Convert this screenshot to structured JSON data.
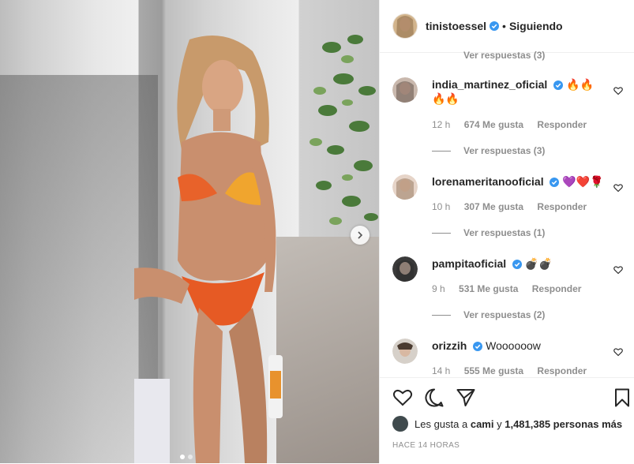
{
  "post": {
    "username": "tinistoessel",
    "bullet": "•",
    "follow_status": "Siguiendo"
  },
  "comments": {
    "top_replies": "Ver respuestas (3)",
    "items": [
      {
        "user": "india_martinez_oficial",
        "text": "🔥🔥🔥🔥",
        "time": "12 h",
        "likes": "674 Me gusta",
        "reply": "Responder",
        "replies": "Ver respuestas (3)"
      },
      {
        "user": "lorenameritanooficial",
        "text": "💜❤️🌹",
        "time": "10 h",
        "likes": "307 Me gusta",
        "reply": "Responder",
        "replies": "Ver respuestas (1)"
      },
      {
        "user": "pampitaoficial",
        "text": "💣💣",
        "time": "9 h",
        "likes": "531 Me gusta",
        "reply": "Responder",
        "replies": "Ver respuestas (2)"
      },
      {
        "user": "orizzih",
        "text": "Woooooow",
        "time": "14 h",
        "likes": "555 Me gusta",
        "reply": "Responder"
      }
    ]
  },
  "likes": {
    "prefix": "Les gusta a",
    "user": "cami",
    "conj": "y",
    "rest": "1,481,385 personas más"
  },
  "timestamp": "HACE 14 HORAS",
  "colors": {
    "text": "#262626",
    "secondary": "#8e8e8e",
    "verified": "#3897f0",
    "border": "#efefef"
  },
  "icons": [
    "verified-icon",
    "heart-icon",
    "comment-icon",
    "share-icon",
    "bookmark-icon",
    "chevron-right-icon"
  ],
  "carousel": {
    "slides": 2,
    "active_slide": 1
  }
}
